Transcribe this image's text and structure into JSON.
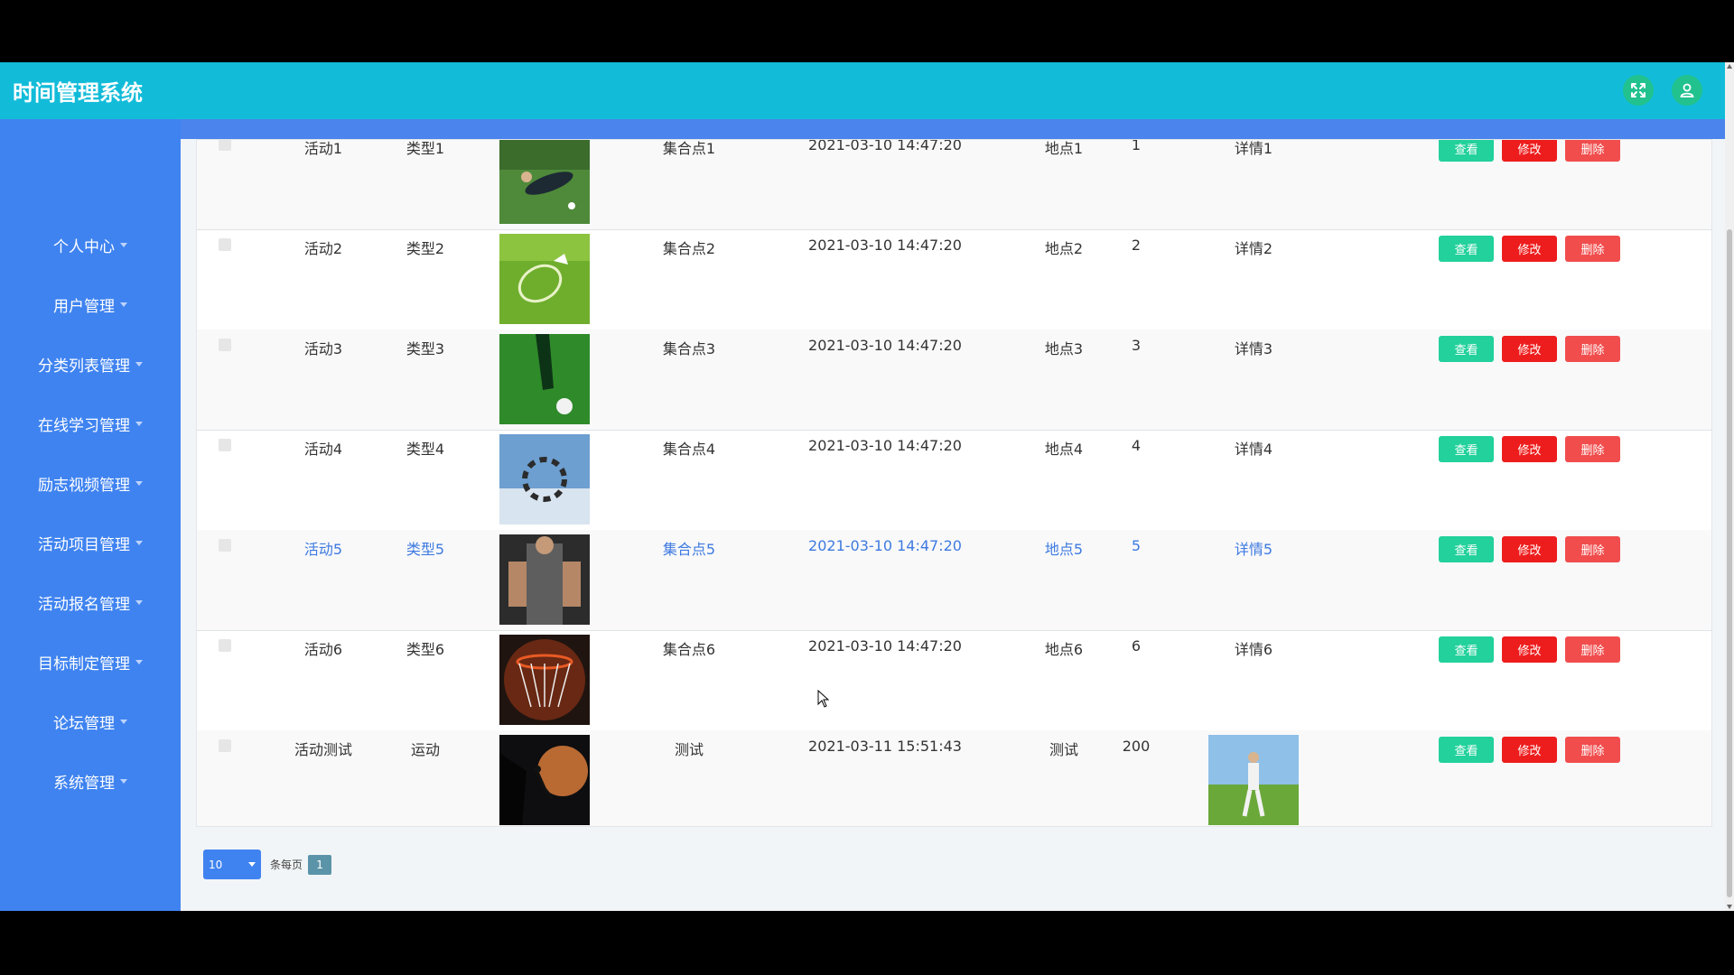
{
  "app": {
    "title": "时间管理系统"
  },
  "colors": {
    "header": "#12bcd9",
    "sidebar": "#3f83f0",
    "view": "#22d19b",
    "edit": "#ee1d1d",
    "delete": "#f14d4d",
    "link": "#3e7ae0"
  },
  "header_icons": {
    "fullscreen": "fullscreen-icon",
    "user": "user-icon"
  },
  "sidebar": {
    "items": [
      {
        "label": "个人中心"
      },
      {
        "label": "用户管理"
      },
      {
        "label": "分类列表管理"
      },
      {
        "label": "在线学习管理"
      },
      {
        "label": "励志视频管理"
      },
      {
        "label": "活动项目管理"
      },
      {
        "label": "活动报名管理"
      },
      {
        "label": "目标制定管理"
      },
      {
        "label": "论坛管理"
      },
      {
        "label": "系统管理"
      }
    ]
  },
  "buttons": {
    "view": "查看",
    "edit": "修改",
    "delete": "删除"
  },
  "rows": [
    {
      "name": "活动1",
      "type": "类型1",
      "image": "soccer-tackle-photo",
      "meet": "集合点1",
      "time": "2021-03-10 14:47:20",
      "place": "地点1",
      "count": "1",
      "detail": "详情1"
    },
    {
      "name": "活动2",
      "type": "类型2",
      "image": "badminton-photo",
      "meet": "集合点2",
      "time": "2021-03-10 14:47:20",
      "place": "地点2",
      "count": "2",
      "detail": "详情2"
    },
    {
      "name": "活动3",
      "type": "类型3",
      "image": "football-kick-photo",
      "meet": "集合点3",
      "time": "2021-03-10 14:47:20",
      "place": "地点3",
      "count": "3",
      "detail": "详情3"
    },
    {
      "name": "活动4",
      "type": "类型4",
      "image": "skydiving-photo",
      "meet": "集合点4",
      "time": "2021-03-10 14:47:20",
      "place": "地点4",
      "count": "4",
      "detail": "详情4"
    },
    {
      "name": "活动5",
      "type": "类型5",
      "image": "gym-photo",
      "meet": "集合点5",
      "time": "2021-03-10 14:47:20",
      "place": "地点5",
      "count": "5",
      "detail": "详情5"
    },
    {
      "name": "活动6",
      "type": "类型6",
      "image": "basketball-hoop-photo",
      "meet": "集合点6",
      "time": "2021-03-10 14:47:20",
      "place": "地点6",
      "count": "6",
      "detail": "详情6"
    },
    {
      "name": "活动测试",
      "type": "运动",
      "image": "climbing-photo",
      "meet": "测试",
      "time": "2021-03-11 15:51:43",
      "place": "测试",
      "count": "200",
      "detail": "",
      "detail_image": "golfer-photo"
    }
  ],
  "pager": {
    "page_size": "10",
    "label": "条每页",
    "current_page": "1"
  }
}
